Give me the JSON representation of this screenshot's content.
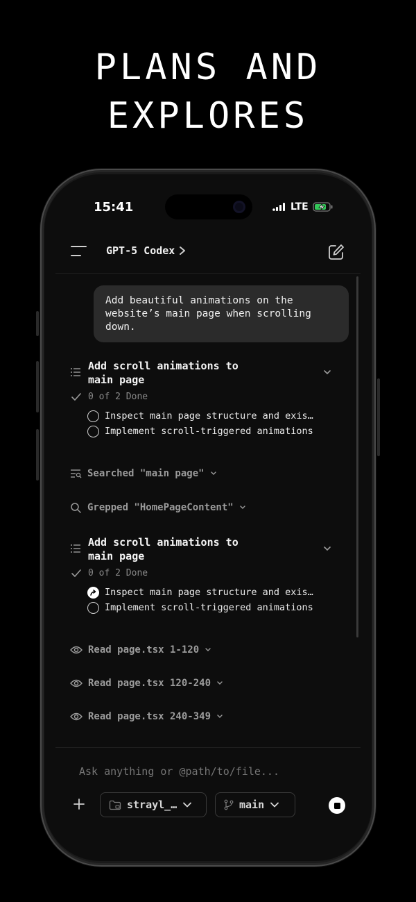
{
  "headline": {
    "line1": "PLANS AND",
    "line2": "EXPLORES"
  },
  "status_bar": {
    "time": "15:41",
    "network": "LTE"
  },
  "header": {
    "model": "GPT-5 Codex"
  },
  "user_message": "Add beautiful animations on the website’s main page when scrolling down.",
  "plans": [
    {
      "title_line1": "Add scroll animations to",
      "title_line2": "main page",
      "progress": "0 of 2 Done",
      "tasks": [
        {
          "label": "Inspect main page structure and exis…",
          "state": "pending"
        },
        {
          "label": "Implement scroll-triggered animations",
          "state": "pending"
        }
      ]
    },
    {
      "title_line1": "Add scroll animations to",
      "title_line2": "main page",
      "progress": "0 of 2 Done",
      "tasks": [
        {
          "label": "Inspect main page structure and exis…",
          "state": "in-progress"
        },
        {
          "label": "Implement scroll-triggered animations",
          "state": "pending"
        }
      ]
    }
  ],
  "actions": {
    "searched": "Searched \"main page\"",
    "grepped": "Grepped \"HomePageContent\"",
    "read1": "Read page.tsx 1-120",
    "read2": "Read page.tsx 120-240",
    "read3": "Read page.tsx 240-349"
  },
  "composer": {
    "placeholder": "Ask anything or @path/to/file...",
    "repo": "strayl_…",
    "branch": "main"
  }
}
